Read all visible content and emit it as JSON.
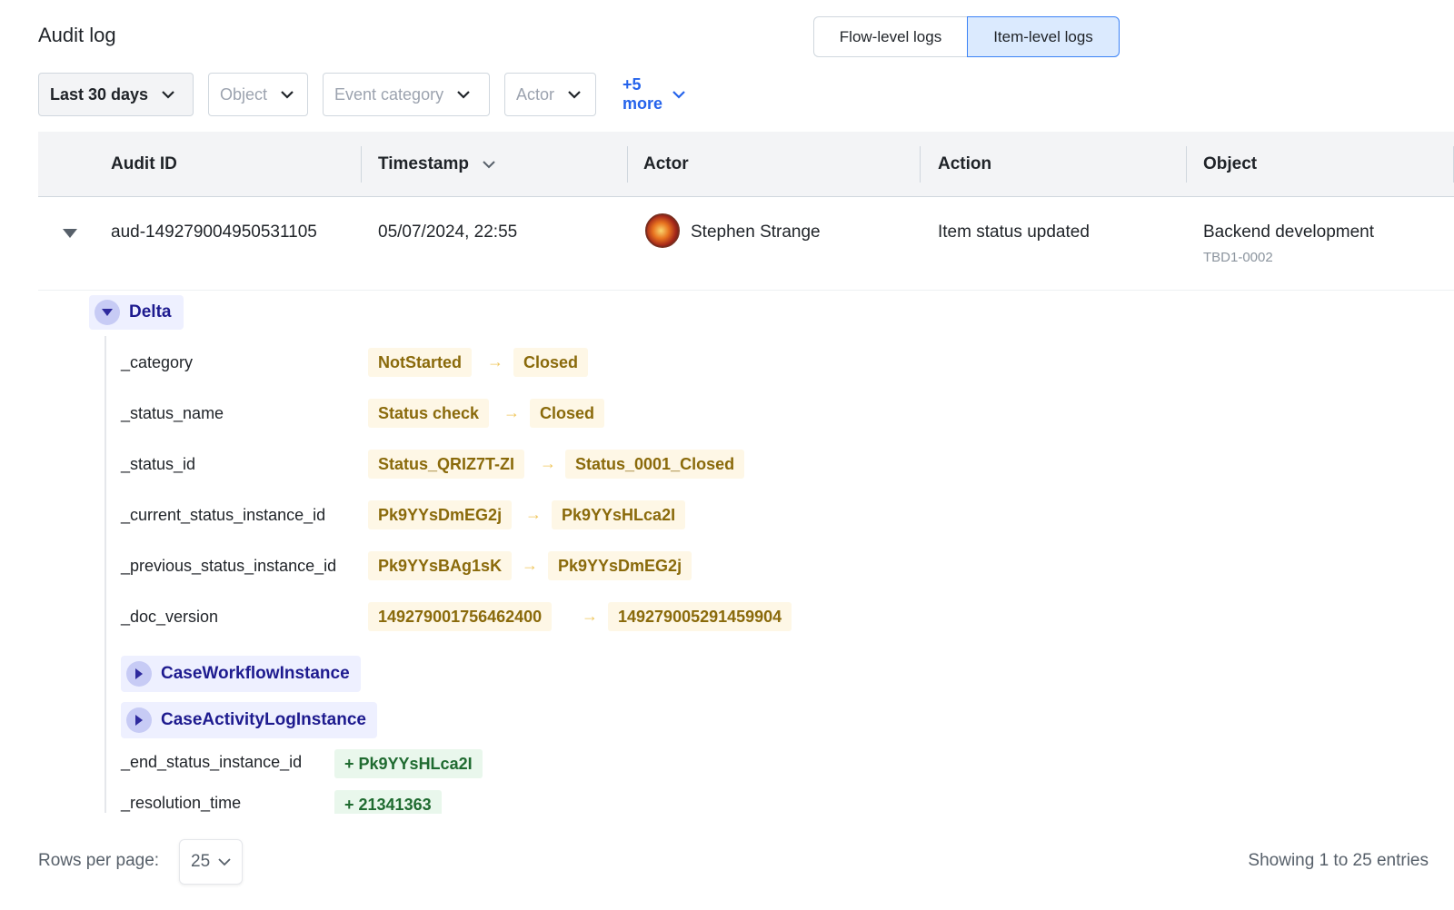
{
  "page": {
    "title": "Audit log"
  },
  "view_toggle": {
    "options": [
      "Flow-level logs",
      "Item-level logs"
    ],
    "selected": "Item-level logs"
  },
  "filters": {
    "date": "Last 30 days",
    "object": "Object",
    "event_category": "Event category",
    "actor": "Actor",
    "more": "+5 more"
  },
  "table": {
    "columns": [
      "Audit ID",
      "Timestamp",
      "Actor",
      "Action",
      "Object"
    ],
    "sorted_column": "Timestamp",
    "rows": [
      {
        "audit_id": "aud-149279004950531105",
        "timestamp": "05/07/2024, 22:55",
        "actor": "Stephen Strange",
        "action": "Item status updated",
        "object": "Backend development",
        "object_id": "TBD1-0002"
      }
    ]
  },
  "delta": {
    "label": "Delta",
    "changes": [
      {
        "key": "_category",
        "from": "NotStarted",
        "to": "Closed"
      },
      {
        "key": "_status_name",
        "from": "Status check",
        "to": "Closed"
      },
      {
        "key": "_status_id",
        "from": "Status_QRIZ7T-ZI",
        "to": "Status_0001_Closed"
      },
      {
        "key": "_current_status_instance_id",
        "from": "Pk9YYsDmEG2j",
        "to": "Pk9YYsHLca2I"
      },
      {
        "key": "_previous_status_instance_id",
        "from": "Pk9YYsBAg1sK",
        "to": "Pk9YYsDmEG2j"
      },
      {
        "key": "_doc_version",
        "from": "149279001756462400",
        "to": "149279005291459904"
      }
    ],
    "nested": [
      "CaseWorkflowInstance",
      "CaseActivityLogInstance"
    ],
    "added": [
      {
        "key": "_end_status_instance_id",
        "value": "+ Pk9YYsHLca2I"
      },
      {
        "key": "_resolution_time",
        "value": "+ 21341363"
      }
    ]
  },
  "pagination": {
    "rows_per_page_label": "Rows per page:",
    "rows_per_page": "25",
    "showing": "Showing 1 to 25 entries"
  },
  "colors": {
    "accent": "#2563eb",
    "toggle_active": "#dbeafe",
    "delta_bg": "#eef0ff",
    "old_chip": "#fef7e6",
    "added_chip": "#e9f7ec"
  }
}
